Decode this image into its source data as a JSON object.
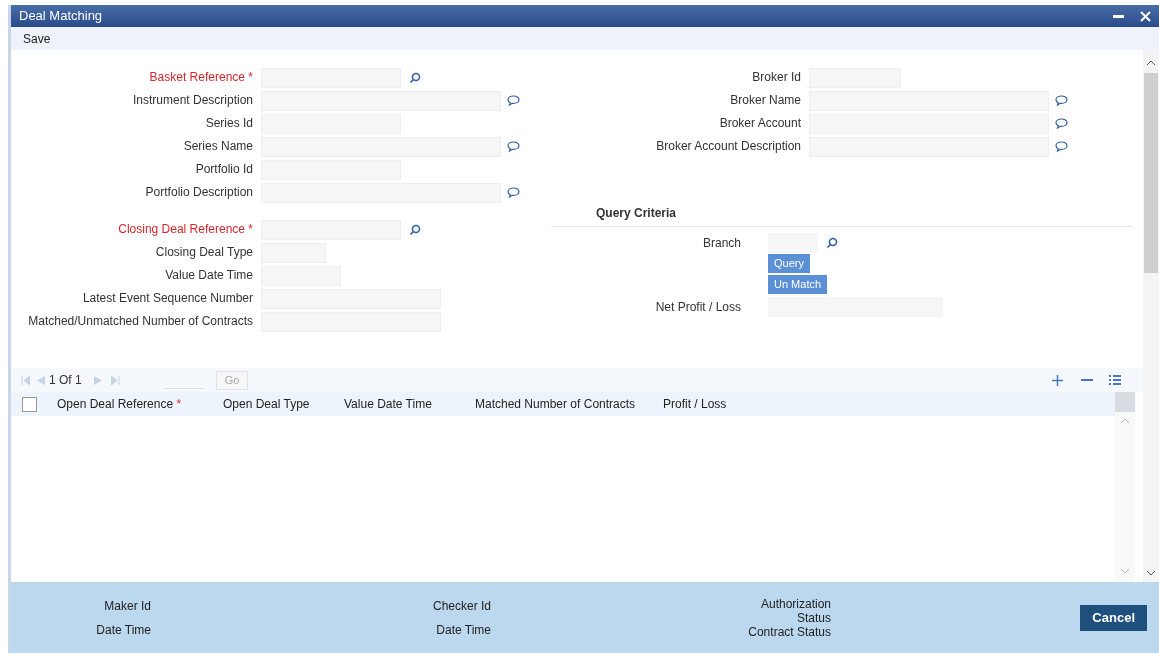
{
  "window": {
    "title": "Deal Matching"
  },
  "toolbar": {
    "items": [
      "Save"
    ]
  },
  "left_fields": [
    {
      "label": "Basket Reference",
      "required": true,
      "required_mark": "*",
      "kind": "search"
    },
    {
      "label": "Instrument Description",
      "required": false,
      "kind": "comment"
    },
    {
      "label": "Series Id",
      "required": false,
      "kind": "plain"
    },
    {
      "label": "Series Name",
      "required": false,
      "kind": "comment"
    },
    {
      "label": "Portfolio Id",
      "required": false,
      "kind": "plain"
    },
    {
      "label": "Portfolio Description",
      "required": false,
      "kind": "comment"
    },
    {
      "label": "Closing Deal Reference",
      "required": true,
      "required_mark": "*",
      "kind": "search"
    },
    {
      "label": "Closing Deal Type",
      "required": false,
      "kind": "plain"
    },
    {
      "label": "Value Date Time",
      "required": false,
      "kind": "plain"
    },
    {
      "label": "Latest Event Sequence Number",
      "required": false,
      "kind": "plain"
    },
    {
      "label": "Matched/Unmatched Number of Contracts",
      "required": false,
      "kind": "plain"
    }
  ],
  "right_fields": [
    {
      "label": "Broker Id",
      "required": false,
      "kind": "plain"
    },
    {
      "label": "Broker Name",
      "required": false,
      "kind": "comment"
    },
    {
      "label": "Broker Account",
      "required": false,
      "kind": "comment"
    },
    {
      "label": "Broker Account Description",
      "required": false,
      "kind": "comment"
    }
  ],
  "query_criteria": {
    "heading": "Query Criteria",
    "branch": {
      "label": "Branch",
      "kind": "search"
    },
    "buttons": [
      "Query",
      "Un Match"
    ],
    "net": {
      "label": "Net Profit / Loss"
    }
  },
  "grid": {
    "pager": "1 Of 1",
    "go": {
      "label": "Go",
      "disabled": true
    },
    "columns": [
      {
        "label": "Open Deal Reference",
        "required_mark": "*"
      },
      {
        "label": "Open Deal Type"
      },
      {
        "label": "Value Date Time"
      },
      {
        "label": "Matched Number of Contracts"
      },
      {
        "label": "Profit / Loss"
      }
    ],
    "select_all": {
      "checked": false
    }
  },
  "footer": {
    "col_1": [
      "Maker Id",
      "Date Time"
    ],
    "col_2": [
      "Checker Id",
      "Date Time"
    ],
    "col_3": [
      "Authorization Status",
      "Contract Status"
    ],
    "cancel": "Cancel"
  }
}
